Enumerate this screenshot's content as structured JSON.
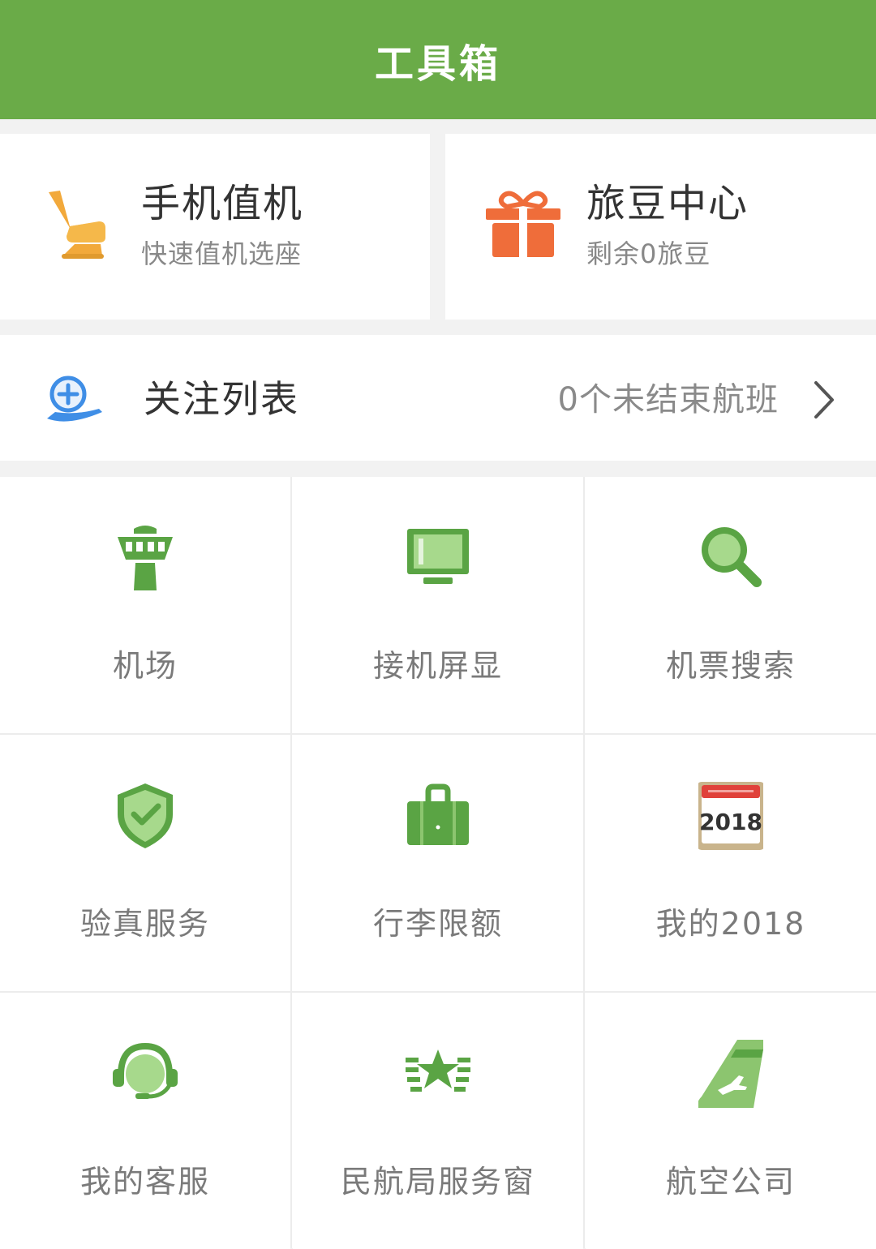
{
  "header": {
    "title": "工具箱",
    "bg": "#6aab48"
  },
  "cards": {
    "checkin": {
      "title": "手机值机",
      "subtitle": "快速值机选座",
      "icon": "seat-icon",
      "color": "#f2a93b"
    },
    "beans": {
      "title": "旅豆中心",
      "subtitle": "剩余0旅豆",
      "icon": "gift-icon",
      "color": "#ef6d3a"
    }
  },
  "follow": {
    "label": "关注列表",
    "status": "0个未结束航班",
    "icon": "follow-plane-icon",
    "chevron": "chevron-right-icon"
  },
  "grid": {
    "items": [
      {
        "label": "机场",
        "icon": "control-tower-icon"
      },
      {
        "label": "接机屏显",
        "icon": "monitor-icon"
      },
      {
        "label": "机票搜索",
        "icon": "search-icon"
      },
      {
        "label": "验真服务",
        "icon": "shield-check-icon"
      },
      {
        "label": "行李限额",
        "icon": "luggage-icon"
      },
      {
        "label": "我的2018",
        "icon": "calendar-2018-icon",
        "icon_text": "2018"
      },
      {
        "label": "我的客服",
        "icon": "headset-icon"
      },
      {
        "label": "民航局服务窗",
        "icon": "caac-emblem-icon"
      },
      {
        "label": "航空公司",
        "icon": "airline-tail-icon"
      }
    ]
  }
}
